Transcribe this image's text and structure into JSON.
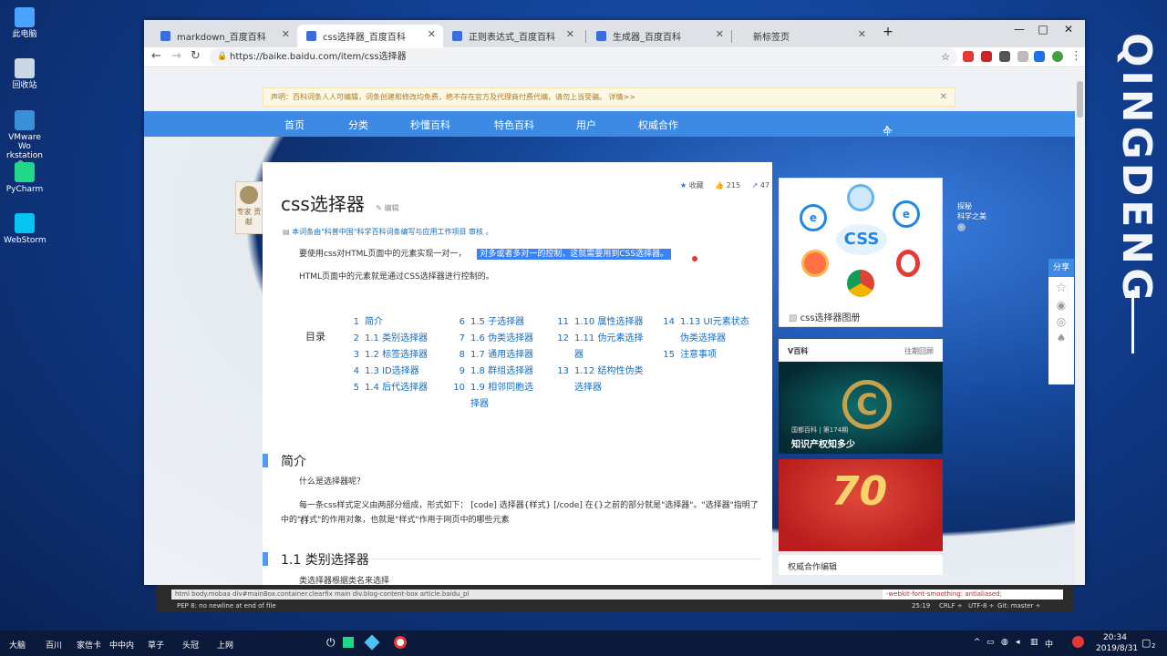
{
  "desktop": {
    "icons": [
      {
        "label": "此电脑",
        "color": "#4aa3ff"
      },
      {
        "label": "回收站",
        "color": "#c9d6e6"
      },
      {
        "label": "VMware Wo rkstation Pro",
        "color": "#3a8fd6"
      },
      {
        "label": "PyCharm",
        "color": "#21d789"
      },
      {
        "label": "WebStorm",
        "color": "#07c3f2"
      }
    ],
    "watermark": "QINGDENG"
  },
  "browser": {
    "tabs": [
      {
        "label": "markdown_百度百科",
        "active": false
      },
      {
        "label": "css选择器_百度百科",
        "active": true
      },
      {
        "label": "正则表达式_百度百科",
        "active": false
      },
      {
        "label": "生成器_百度百科",
        "active": false
      },
      {
        "label": "新标签页",
        "active": false
      }
    ],
    "url": "https://baike.baidu.com/item/css选择器",
    "win_minimize": "—",
    "win_maximize": "□",
    "win_close": "✕",
    "new_tab": "+"
  },
  "page": {
    "notice": "声明：百科词条人人可编辑，词条创建和修改均免费，绝不存在官方及代理商付费代编，请勿上当受骗。 详情>>",
    "nav": [
      "首页",
      "分类",
      "秒懂百科",
      "特色百科",
      "用户",
      "权威合作"
    ],
    "user_center": "个人中心",
    "expert_badge": "专家 贡献",
    "title": "css选择器",
    "edit": "编辑",
    "collect": "收藏",
    "likes": "215",
    "share_count": "47",
    "source_note": "本词条由\"科普中国\"科学百科词条编写与应用工作项目 审核 。",
    "intro_1": "要使用css对HTML页面中的元素实现一对一，",
    "intro_1b": "对多或者多对一的控制，这就需要用到CSS选择器。",
    "intro_2": "HTML页面中的元素就是通过CSS选择器进行控制的。",
    "toc_label": "目录",
    "toc": [
      {
        "num": "1",
        "text": "简介"
      },
      {
        "num": "2",
        "text": "1.1 类别选择器"
      },
      {
        "num": "3",
        "text": "1.2 标签选择器"
      },
      {
        "num": "4",
        "text": "1.3 ID选择器"
      },
      {
        "num": "5",
        "text": "1.4 后代选择器"
      },
      {
        "num": "6",
        "text": "1.5 子选择器"
      },
      {
        "num": "7",
        "text": "1.6 伪类选择器"
      },
      {
        "num": "8",
        "text": "1.7 通用选择器"
      },
      {
        "num": "9",
        "text": "1.8 群组选择器"
      },
      {
        "num": "10",
        "text": "1.9 相邻同胞选"
      },
      {
        "num": "",
        "text": "择器"
      },
      {
        "num": "11",
        "text": "1.10 属性选择器"
      },
      {
        "num": "12",
        "text": "1.11 伪元素选择"
      },
      {
        "num": "",
        "text": "器"
      },
      {
        "num": "13",
        "text": "1.12 结构性伪类"
      },
      {
        "num": "",
        "text": "选择器"
      },
      {
        "num": "14",
        "text": "1.13 UI元素状态"
      },
      {
        "num": "",
        "text": "伪类选择器"
      },
      {
        "num": "15",
        "text": "注意事项"
      }
    ],
    "sec1_title": "简介",
    "sec1_p1": "什么是选择器呢？",
    "sec1_p2a": "每一条css样式定义由两部分组成，形式如下： [code] 选择器{样式} [/code] 在{}之前的部分就是\"选择器\"。\"选择器\"指明了{}",
    "sec1_p2b": "中的\"样式\"的作用对象，也就是\"样式\"作用于网页中的哪些元素",
    "sec2_title": "1.1 类别选择器",
    "sec2_p1": "类选择器根据类名来选择",
    "album_caption": "css选择器图册",
    "css_logo": "CSS",
    "vbaike": "V百科",
    "vbaike_more": "往期回顾",
    "video1_tag": "国都百科 | 第174期",
    "video1_title": "知识产权知多少",
    "authority": "权威合作编辑",
    "share_label": "分享",
    "side_promo_1": "探秘",
    "side_promo_2": "科学之美"
  },
  "devtools": {
    "breadcrumb": "html  body.mobaa  div#mainBox.container.clearfix  main  div.blog-content-box  article.baidu_pl",
    "status": "PEP 8: no newline at end of file",
    "position": "25:19",
    "crlf": "CRLF ÷",
    "enc": "UTF-8 ÷",
    "git": "Git: master ÷",
    "code_right": "-webkit-font-smoothing: antialiased;"
  },
  "taskbar": {
    "items": [
      "大脑",
      "百川",
      "家信卡",
      "中中内",
      "草子",
      "头冠",
      "上网"
    ],
    "time": "20:34",
    "date": "2019/8/31",
    "notif": "2"
  }
}
